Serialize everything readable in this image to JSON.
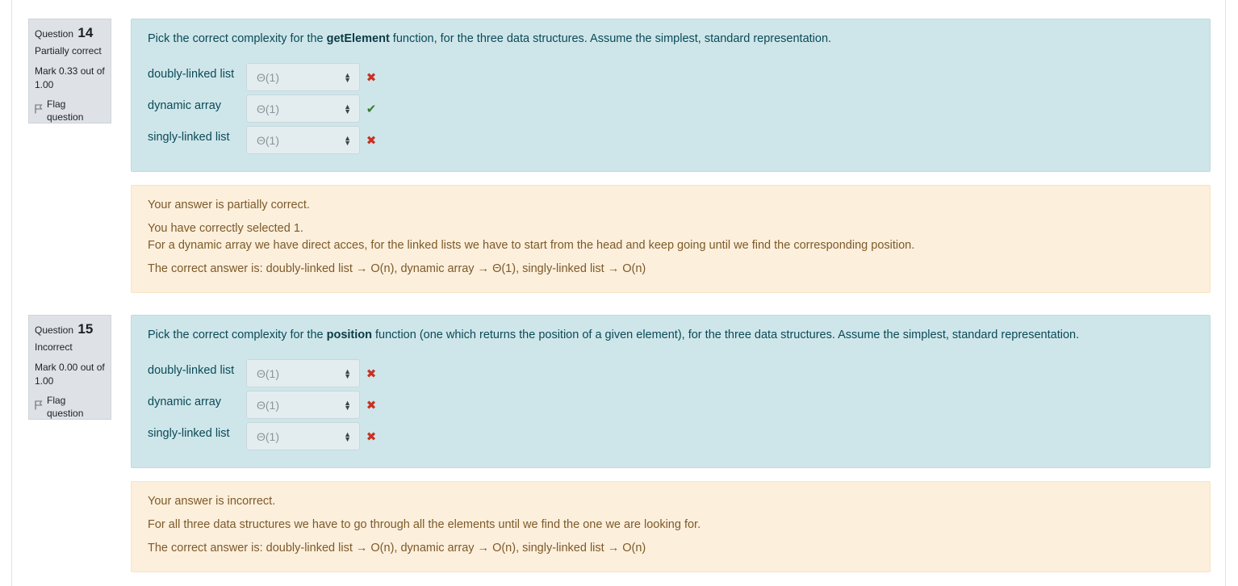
{
  "questions": [
    {
      "label": "Question",
      "number": "14",
      "state": "Partially correct",
      "grade": "Mark 0.33 out of 1.00",
      "flag_label": "Flag question",
      "text_before": "Pick the correct complexity for the ",
      "text_bold": "getElement",
      "text_after": " function, for the three data structures. Assume the simplest, standard representation.",
      "rows": [
        {
          "label": "doubly-linked list",
          "selected": "Θ(1)",
          "result": "incorrect",
          "result_icon": "cross-icon"
        },
        {
          "label": "dynamic array",
          "selected": "Θ(1)",
          "result": "correct",
          "result_icon": "check-icon"
        },
        {
          "label": "singly-linked list",
          "selected": "Θ(1)",
          "result": "incorrect",
          "result_icon": "cross-icon"
        }
      ],
      "feedback": {
        "status": "Your answer is partially correct.",
        "selected_count": "You have correctly selected 1.",
        "general": "For a dynamic array we have direct acces, for the linked lists we have to start from the head and keep going until we find the corresponding position.",
        "right_answer": "The correct answer is: doubly-linked list → O(n), dynamic array → Θ(1), singly-linked list → O(n)"
      }
    },
    {
      "label": "Question",
      "number": "15",
      "state": "Incorrect",
      "grade": "Mark 0.00 out of 1.00",
      "flag_label": "Flag question",
      "text_before": "Pick the correct complexity for the ",
      "text_bold": "position",
      "text_after": " function (one which returns the position of a given element), for the three data structures. Assume the simplest, standard representation.",
      "rows": [
        {
          "label": "doubly-linked list",
          "selected": "Θ(1)",
          "result": "incorrect",
          "result_icon": "cross-icon"
        },
        {
          "label": "dynamic array",
          "selected": "Θ(1)",
          "result": "incorrect",
          "result_icon": "cross-icon"
        },
        {
          "label": "singly-linked list",
          "selected": "Θ(1)",
          "result": "incorrect",
          "result_icon": "cross-icon"
        }
      ],
      "feedback": {
        "status": "Your answer is incorrect.",
        "general": "For all three data structures we have to go through all the elements until we find the one we are looking for.",
        "right_answer": "The correct answer is: doubly-linked list → O(n), dynamic array → O(n), singly-linked list → O(n)"
      }
    }
  ],
  "colors": {
    "formulation_bg": "#cee6ea",
    "feedback_bg": "#fcefdc",
    "info_bg": "#dee2e6",
    "correct": "#357a32",
    "incorrect": "#ca3120"
  }
}
